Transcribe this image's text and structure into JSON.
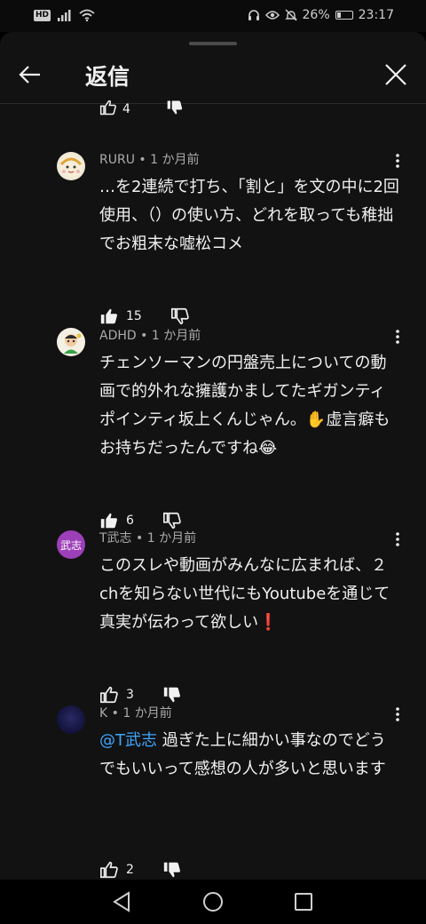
{
  "status_bar": {
    "hd": "HD",
    "battery": "26%",
    "battery_level": 0.26,
    "time": "23:17"
  },
  "header": {
    "title": "返信"
  },
  "previous_comment": {
    "like_count": "4"
  },
  "comments": [
    {
      "author": "RURU",
      "time": "1 か月前",
      "text": "…を2連続で打ち、「割と」を文の中に2回使用、（）の使い方、どれを取っても稚拙でお粗末な嘘松コメ",
      "like_count": "15",
      "liked": true
    },
    {
      "author": "ADHD",
      "time": "1 か月前",
      "text": "チェンソーマンの円盤売上についての動画で的外れな擁護かましてたギガンティポインティ坂上くんじゃん。✋虚言癖もお持ちだったんですね😂",
      "like_count": "6",
      "liked": true
    },
    {
      "author": "T武志",
      "avatar_text": "武志",
      "time": "1 か月前",
      "text": "このスレや動画がみんなに広まれば、２chを知らない世代にもYoutubeを通じて真実が伝わって欲しい❗",
      "like_count": "3",
      "liked": false
    },
    {
      "author": "K",
      "time": "1 か月前",
      "mention": "@T武志",
      "text": " 過ぎた上に細かい事なのでどうでもいいって感想の人が多いと思います",
      "like_count": "2",
      "liked": false
    }
  ],
  "separator": " • ",
  "icons": {
    "back": "arrow-left-icon",
    "close": "close-icon",
    "like": "thumb-up-icon",
    "dislike": "thumb-down-icon",
    "more": "more-vertical-icon"
  },
  "colors": {
    "background": "#121212",
    "mention": "#3ea6ff",
    "avatar_t": "#9c3fb8",
    "avatar_k": "#1c1c48"
  }
}
